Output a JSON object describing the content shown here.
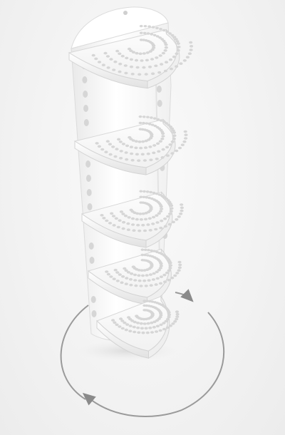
{
  "image": {
    "subject": "product-render",
    "background_color": "#f2f2f2",
    "object_color": "#ffffff",
    "hole_color": "#d6d6d6",
    "arrow_color": "#8a8a8a",
    "shelf_count": 5,
    "icons": [
      "rotate-arrow-icon"
    ]
  }
}
